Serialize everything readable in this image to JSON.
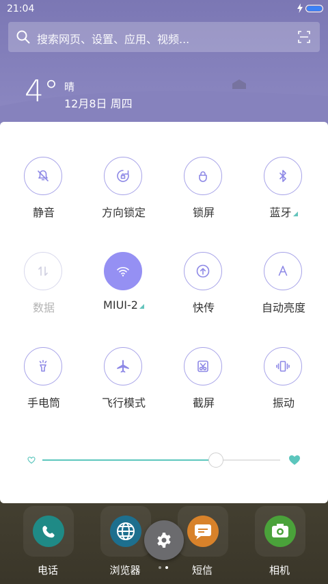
{
  "statusbar": {
    "time": "21:04"
  },
  "search": {
    "placeholder": "搜索网页、设置、应用、视频..."
  },
  "weather": {
    "temperature": "4°",
    "condition": "晴",
    "date": "12月8日 周四"
  },
  "toggles": [
    {
      "id": "mute",
      "label": "静音",
      "icon": "bell-off-icon",
      "state": "inactive"
    },
    {
      "id": "rotation-lock",
      "label": "方向锁定",
      "icon": "rotation-lock-icon",
      "state": "inactive"
    },
    {
      "id": "lock-screen",
      "label": "锁屏",
      "icon": "lock-icon",
      "state": "inactive"
    },
    {
      "id": "bluetooth",
      "label": "蓝牙",
      "icon": "bluetooth-icon",
      "state": "inactive",
      "has_submenu": true
    },
    {
      "id": "mobile-data",
      "label": "数据",
      "icon": "data-arrows-icon",
      "state": "disabled"
    },
    {
      "id": "wifi",
      "label": "MIUI-2",
      "icon": "wifi-icon",
      "state": "active",
      "has_submenu": true
    },
    {
      "id": "quick-transfer",
      "label": "快传",
      "icon": "upload-icon",
      "state": "inactive"
    },
    {
      "id": "auto-brightness",
      "label": "自动亮度",
      "icon": "auto-brightness-icon",
      "state": "inactive"
    },
    {
      "id": "flashlight",
      "label": "手电筒",
      "icon": "flashlight-icon",
      "state": "inactive"
    },
    {
      "id": "airplane",
      "label": "飞行模式",
      "icon": "airplane-icon",
      "state": "inactive"
    },
    {
      "id": "screenshot",
      "label": "截屏",
      "icon": "scissors-icon",
      "state": "inactive"
    },
    {
      "id": "vibrate",
      "label": "振动",
      "icon": "vibrate-icon",
      "state": "inactive"
    }
  ],
  "brightness": {
    "level": 0.73
  },
  "dock": [
    {
      "label": "电话",
      "icon": "phone-icon",
      "color": "#1f8a86"
    },
    {
      "label": "浏览器",
      "icon": "globe-icon",
      "color": "#1d6f8e"
    },
    {
      "label": "短信",
      "icon": "message-icon",
      "color": "#d8822a"
    },
    {
      "label": "相机",
      "icon": "camera-icon",
      "color": "#4aa23a"
    }
  ],
  "colors": {
    "accent": "#9590f3",
    "slider": "#5cc6bd"
  },
  "pager": {
    "pages": 2,
    "current": 2
  }
}
